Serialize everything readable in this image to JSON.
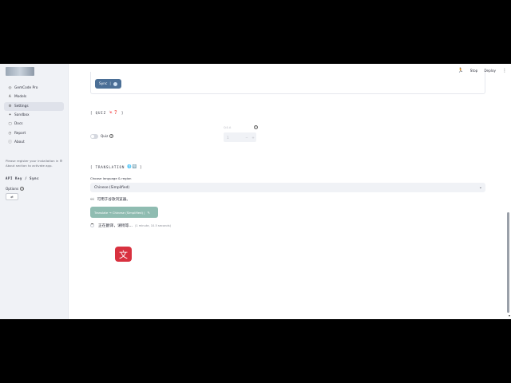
{
  "sidebar": {
    "items": [
      {
        "icon": "home-icon",
        "glyph": "◎",
        "label": "GemCode Pro"
      },
      {
        "icon": "ai-icon",
        "glyph": "Ꭺ",
        "label": "Models"
      },
      {
        "icon": "gear-icon",
        "glyph": "⚙",
        "label": "Settings"
      },
      {
        "icon": "sandbox-icon",
        "glyph": "✦",
        "label": "Sandbox"
      },
      {
        "icon": "docs-icon",
        "glyph": "▢",
        "label": "Docs"
      },
      {
        "icon": "report-icon",
        "glyph": "◷",
        "label": "Report"
      },
      {
        "icon": "info-icon",
        "glyph": "ⓘ",
        "label": "About"
      }
    ],
    "note": "Please register your installation in ⚙ About section to activate app.",
    "api_title": "API Key / Sync",
    "options_label": "Options",
    "options_button": "⇄"
  },
  "topbar": {
    "stop_label": "Stop",
    "deploy_label": "Deploy"
  },
  "main": {
    "sync_label": "Sync",
    "quiz_title": "[ QUIZ",
    "quiz_title_end": "]",
    "quiz_emoji": "🍬❓",
    "quiz_toggle_label": "Quiz",
    "qa_label": "Q&A",
    "qa_value": "1",
    "qa_minus": "−",
    "qa_plus": "+",
    "translation_title": "[ TRANSLATION",
    "translation_title_end": "]",
    "translation_emoji": "🌐🈳",
    "lang_label": "Choose language & region",
    "lang_selected": "Chinese (Simplified)",
    "hint": "可用于谷歌浏览器。",
    "translate_button": "Translate → Chinese (Simplified) |",
    "status_text": "正在翻译，请稍等...",
    "elapsed": "(1 minute, 10.5 seconds)",
    "badge_glyph": "文"
  }
}
